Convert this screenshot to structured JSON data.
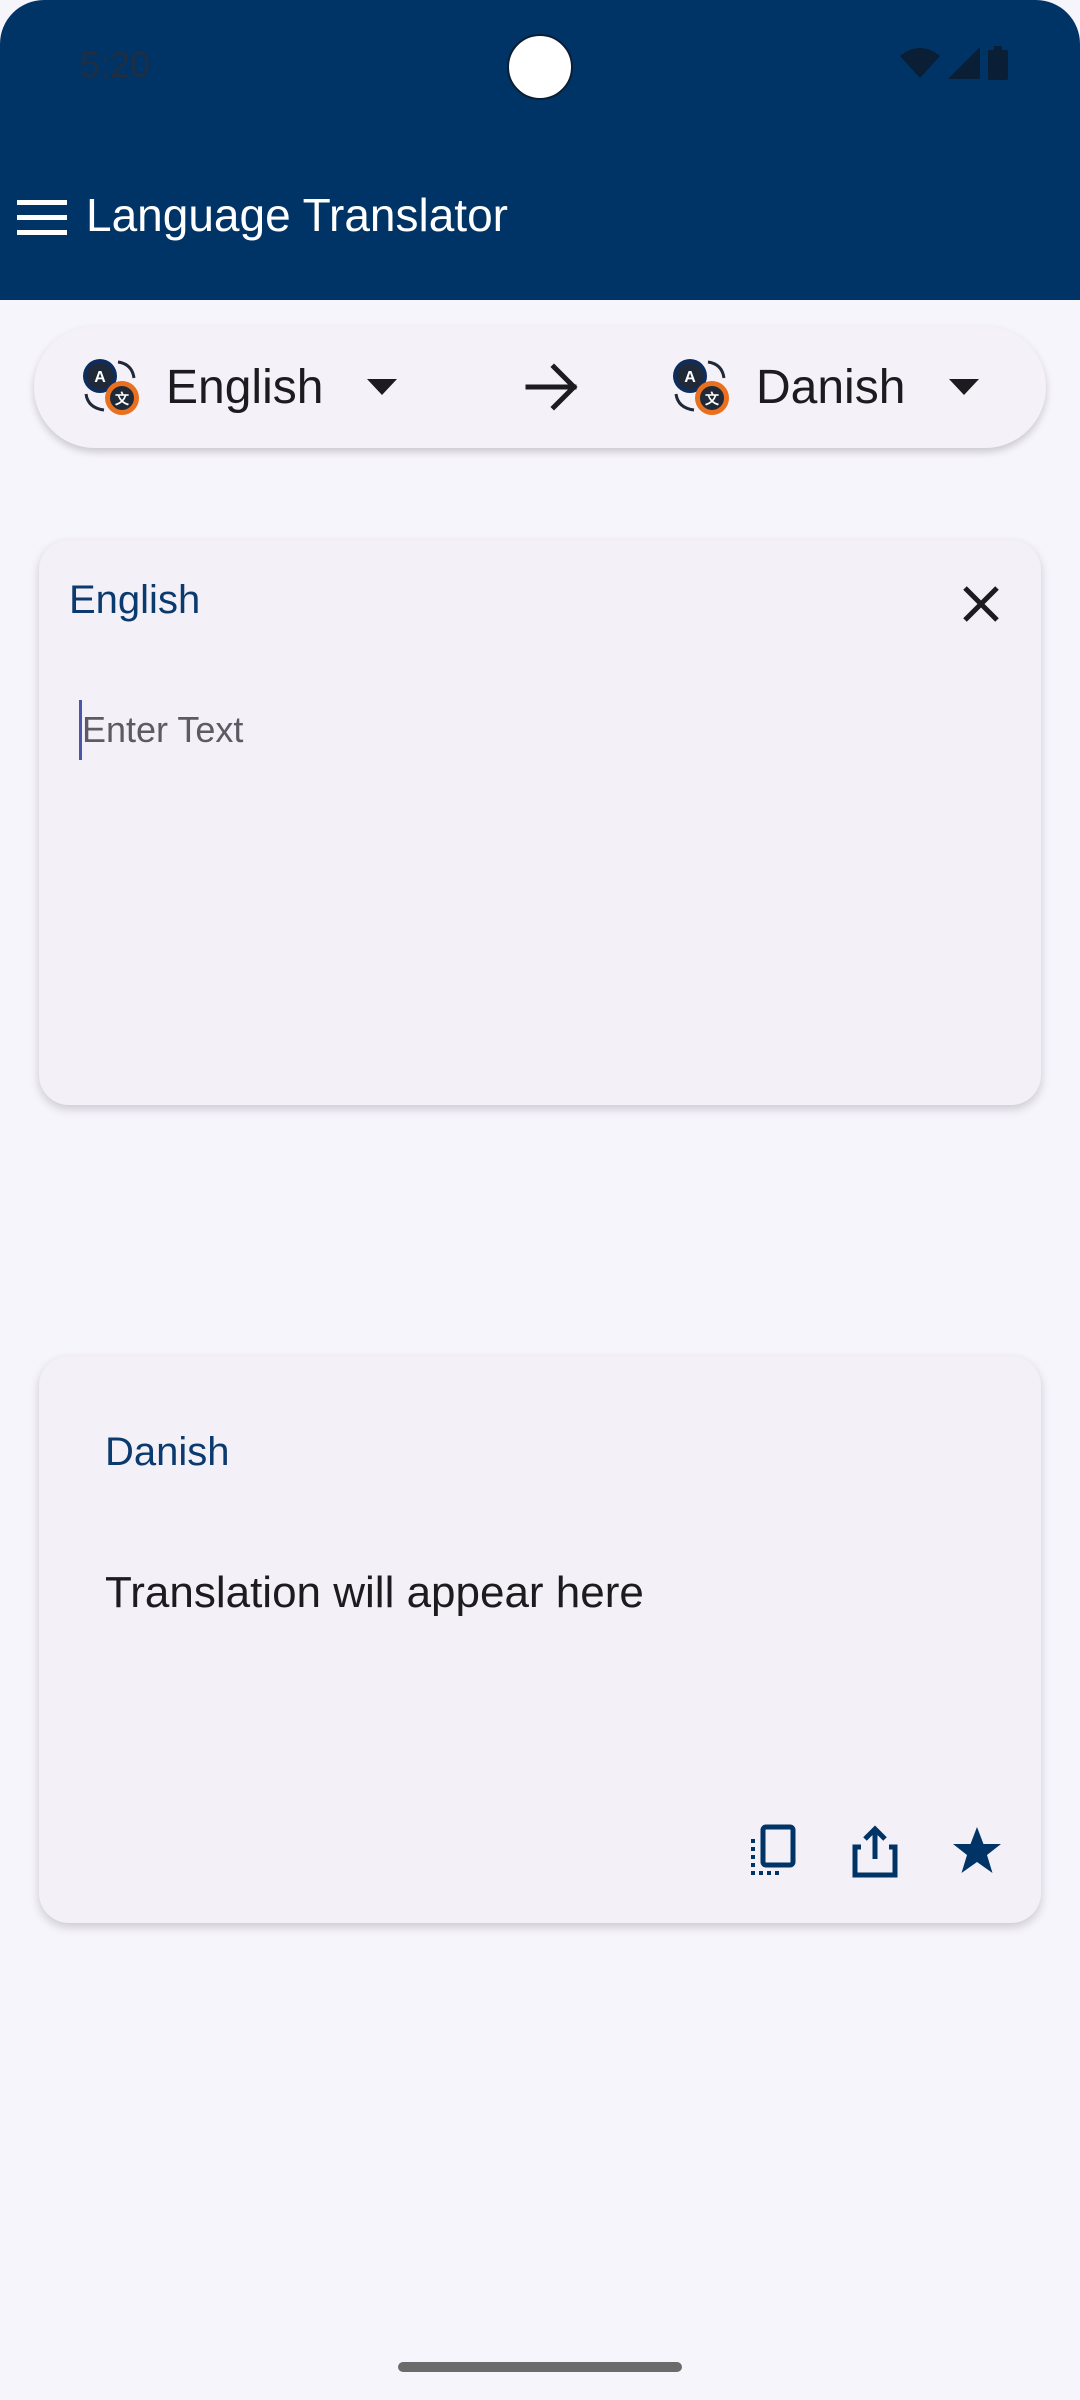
{
  "status_bar": {
    "time": "5:20",
    "icons": [
      "wifi-icon",
      "signal-icon",
      "battery-icon"
    ]
  },
  "app_bar": {
    "title": "Language Translator",
    "menu_icon": "hamburger-menu-icon",
    "background_color": "#003366"
  },
  "language_bar": {
    "source_language": "English",
    "target_language": "Danish",
    "language_icon": "translate-language-icon",
    "dropdown_icon": "dropdown-triangle-icon",
    "swap_icon": "arrow-right-icon"
  },
  "input_card": {
    "language_label": "English",
    "placeholder": "Enter Text",
    "value": "",
    "clear_icon": "close-icon"
  },
  "output_card": {
    "language_label": "Danish",
    "translation_text": "Translation will appear here",
    "actions": [
      "copy-icon",
      "share-icon",
      "star-icon"
    ]
  },
  "colors": {
    "accent": "#0B3B6E",
    "background": "#F7F5FC",
    "card": "#F4F0F7"
  }
}
